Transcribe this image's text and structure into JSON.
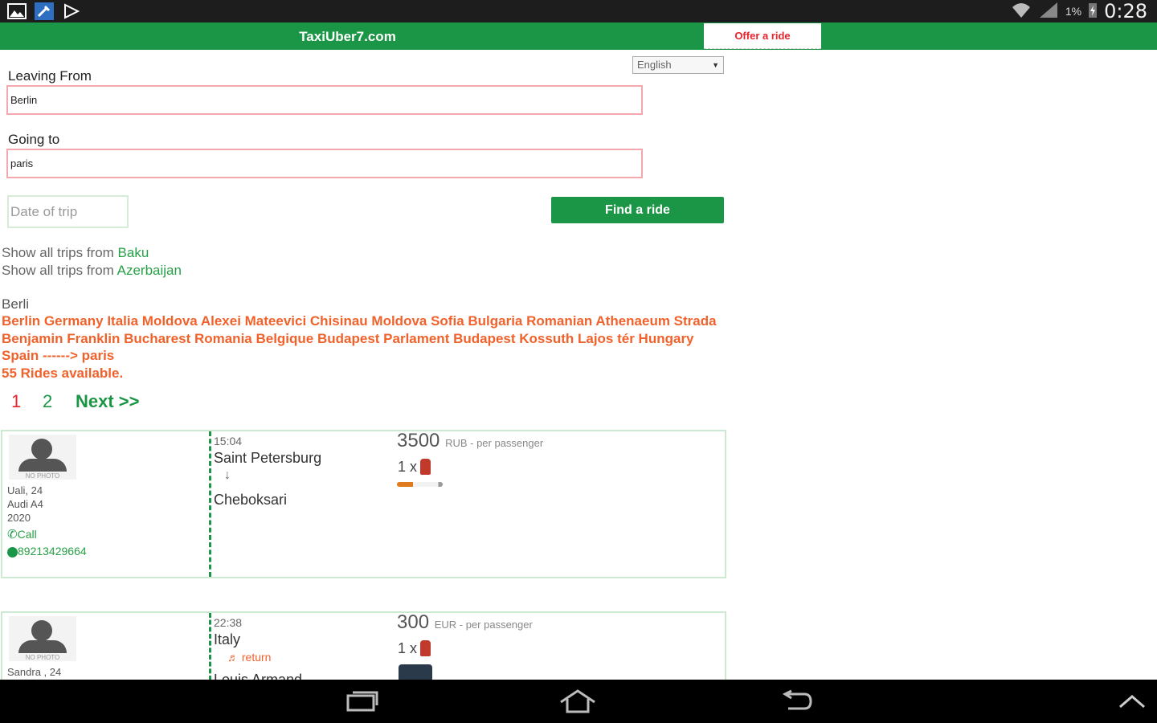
{
  "status_bar": {
    "left_icons": [
      "image-icon",
      "tools-icon",
      "play-store-icon"
    ],
    "battery_text": "1%",
    "time": "0:28"
  },
  "header": {
    "title": "TaxiUber7.com",
    "offer_label": "Offer a ride",
    "language": "English"
  },
  "form": {
    "leaving_label": "Leaving From",
    "leaving_value": "Berlin",
    "going_label": "Going to",
    "going_value": "paris",
    "date_placeholder": "Date of trip",
    "find_label": "Find a ride"
  },
  "links": [
    {
      "prefix": "Show all trips from ",
      "place": "Baku"
    },
    {
      "prefix": "Show all trips from ",
      "place": "Azerbaijan"
    }
  ],
  "search_echo": "Berli",
  "results_text": "Berlin Germany Italia Moldova Alexei Mateevici Chisinau Moldova Sofia Bulgaria Romanian Athenaeum Strada Benjamin Franklin Bucharest Romania Belgique Budapest Parlament Budapest Kossuth Lajos tér Hungary Spain ------> paris",
  "rides_available": "55 Rides available.",
  "pagination": {
    "current": "1",
    "page2": "2",
    "next": "Next >>"
  },
  "rides": [
    {
      "driver": "Uali, 24",
      "car": "Audi A4",
      "year": "2020",
      "call": "Call",
      "phone": "89213429664",
      "time": "15:04",
      "from": "Saint Petersburg",
      "to": "Cheboksari",
      "price": "3500",
      "price_note": "RUB - per passenger",
      "seats": "1 x",
      "no_photo": "NO PHOTO"
    },
    {
      "driver": "Sandra , 24",
      "time": "22:38",
      "from": "Italy",
      "return": "return",
      "to": "Louis Armand",
      "price": "300",
      "price_note": "EUR - per passenger",
      "seats": "1 x",
      "no_photo": "NO PHOTO"
    }
  ],
  "colors": {
    "brand_green": "#1b9646",
    "accent_red": "#e8232b",
    "results_orange": "#f0622c"
  }
}
